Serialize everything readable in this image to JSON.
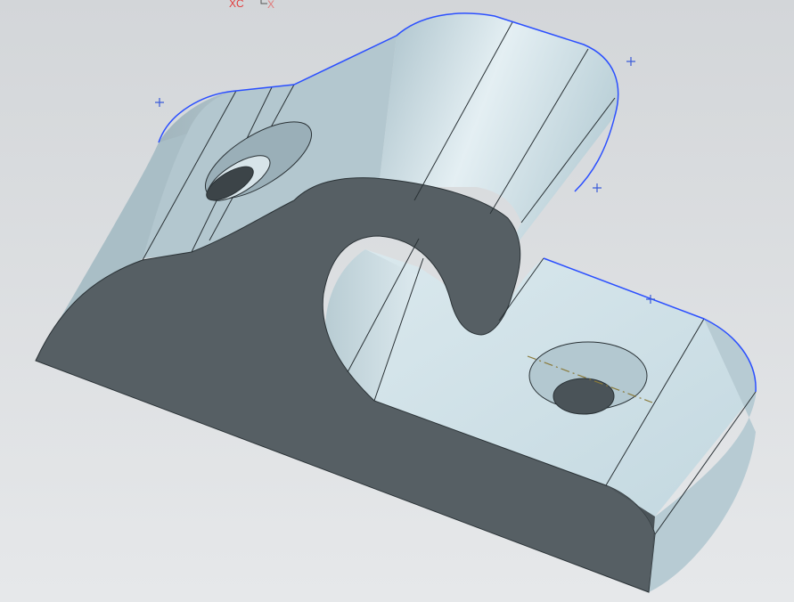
{
  "viewport": {
    "background_top": "#d3d6d9",
    "background_bottom": "#e6e8ea"
  },
  "triad": {
    "xc_label": "XC",
    "x_label": "X",
    "xc_color": "#e23a3a",
    "x_color": "#e07a7a"
  },
  "model": {
    "light_face_color": "#c9dde5",
    "side_face_color": "#a6bcc5",
    "dark_face_color": "#555f64",
    "edge_color": "#2a3236",
    "selection_color": "#2b4fff",
    "centerline_color": "#8a7a3a",
    "hole_inner_color": "#3c4448"
  },
  "markers": {
    "symbol": "+",
    "color": "#3a5bd9",
    "count": 4
  }
}
